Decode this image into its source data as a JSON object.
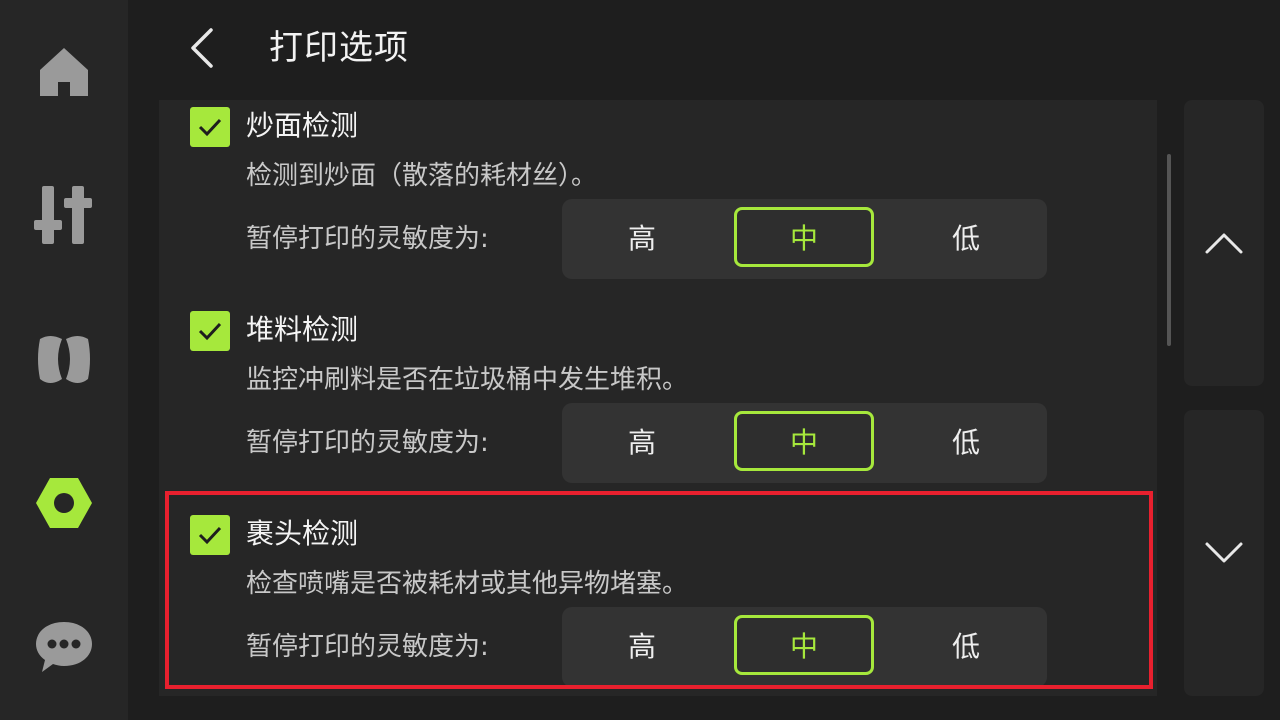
{
  "header": {
    "title": "打印选项"
  },
  "sidebar": {
    "items": [
      {
        "icon": "home-icon"
      },
      {
        "icon": "sliders-icon"
      },
      {
        "icon": "filament-icon"
      },
      {
        "icon": "settings-nut-icon",
        "active": true
      },
      {
        "icon": "chat-icon"
      }
    ]
  },
  "options": [
    {
      "title": "炒面检测",
      "description": "检测到炒面（散落的耗材丝）。",
      "sensitivity_label": "暂停打印的灵敏度为:",
      "levels": [
        "高",
        "中",
        "低"
      ],
      "selected": "中",
      "checked": true
    },
    {
      "title": "堆料检测",
      "description": "监控冲刷料是否在垃圾桶中发生堆积。",
      "sensitivity_label": "暂停打印的灵敏度为:",
      "levels": [
        "高",
        "中",
        "低"
      ],
      "selected": "中",
      "checked": true
    },
    {
      "title": "裹头检测",
      "description": "检查喷嘴是否被耗材或其他异物堵塞。",
      "sensitivity_label": "暂停打印的灵敏度为:",
      "levels": [
        "高",
        "中",
        "低"
      ],
      "selected": "中",
      "checked": true
    }
  ],
  "colors": {
    "accent": "#a6e83c",
    "highlight": "#e8202e",
    "background": "#1e1e1e",
    "panel": "#262626"
  }
}
